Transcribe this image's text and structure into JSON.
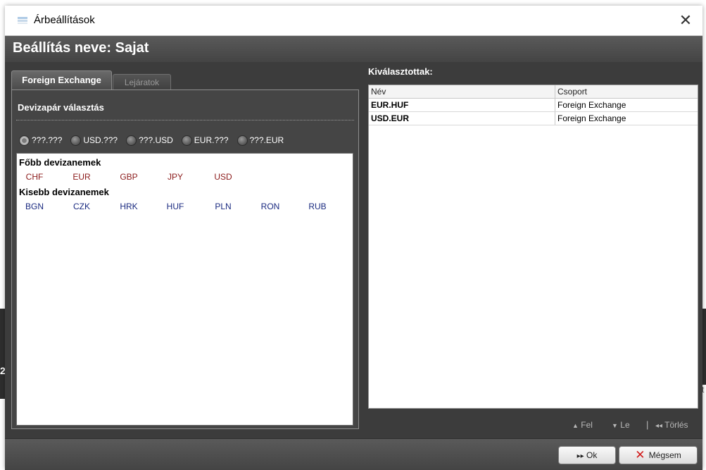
{
  "window": {
    "title": "Árbeállítások",
    "close_glyph": "✕"
  },
  "header": {
    "title": "Beállítás neve: Sajat"
  },
  "tabs": [
    {
      "label": "Foreign Exchange",
      "active": true
    },
    {
      "label": "Lejáratok",
      "active": false
    }
  ],
  "pair_selection": {
    "title": "Devizapár választás",
    "options": [
      {
        "label": "???.???",
        "selected": true
      },
      {
        "label": "USD.???",
        "selected": false
      },
      {
        "label": "???.USD",
        "selected": false
      },
      {
        "label": "EUR.???",
        "selected": false
      },
      {
        "label": "???.EUR",
        "selected": false
      }
    ]
  },
  "currencies": {
    "major_title": "Főbb devizanemek",
    "major": [
      "CHF",
      "EUR",
      "GBP",
      "JPY",
      "USD"
    ],
    "minor_title": "Kisebb devizanemek",
    "minor": [
      "BGN",
      "CZK",
      "HRK",
      "HUF",
      "PLN",
      "RON",
      "RUB"
    ]
  },
  "selected": {
    "title": "Kiválasztottak:",
    "columns": [
      "Név",
      "Csoport"
    ],
    "rows": [
      {
        "name": "EUR.HUF",
        "group": "Foreign Exchange"
      },
      {
        "name": "USD.EUR",
        "group": "Foreign Exchange"
      }
    ]
  },
  "actions": {
    "up": "Fel",
    "up_icon": "▲",
    "down": "Le",
    "down_icon": "▼",
    "separator": "|",
    "delete": "Törlés",
    "delete_icon": "◂◂"
  },
  "buttons": {
    "ok": "Ok",
    "ok_icon": "▸▸",
    "cancel": "Mégsem",
    "cancel_icon": "✕"
  },
  "background": {
    "left_glyph": "2",
    "right_glyph": "t"
  },
  "colors": {
    "major_currency": "#8b1a1a",
    "minor_currency": "#1a2a80",
    "cancel_x": "#d11a1a"
  }
}
